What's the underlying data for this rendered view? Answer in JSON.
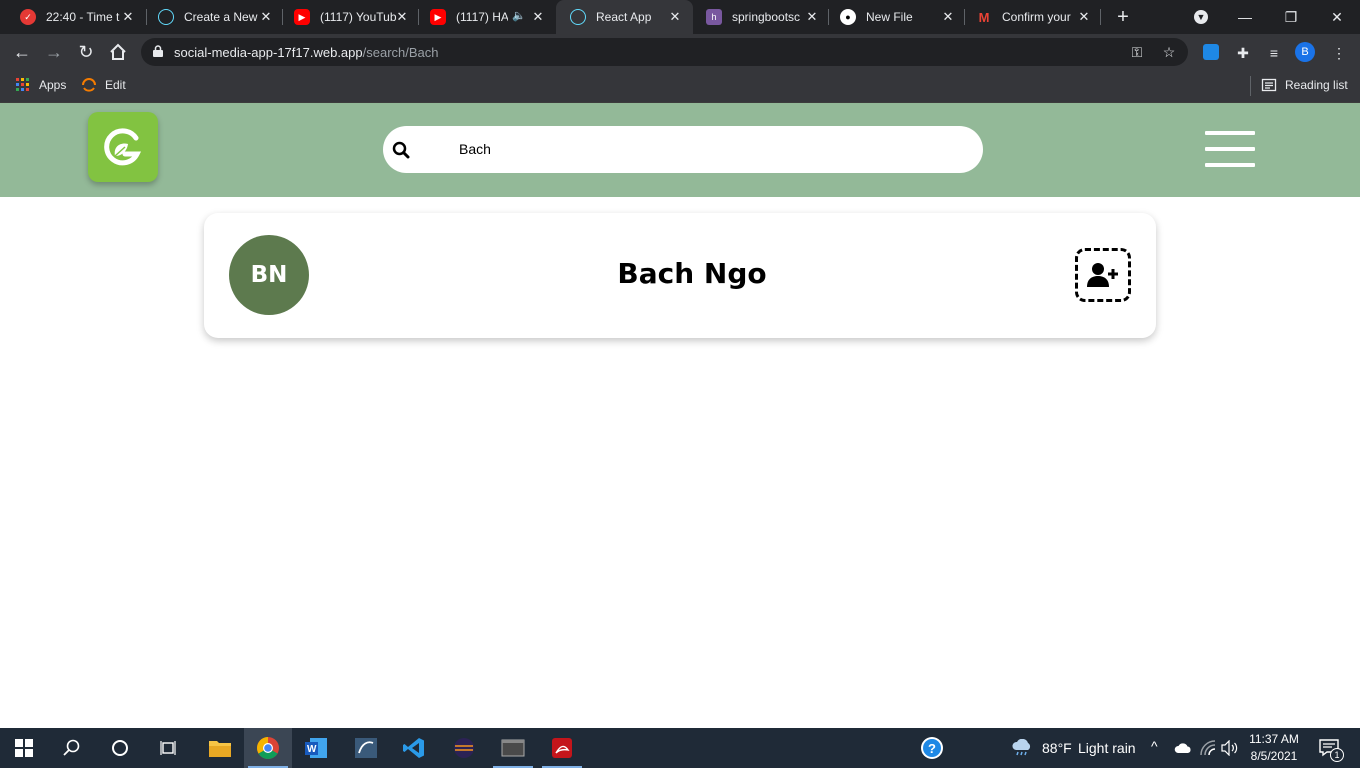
{
  "browser": {
    "tabs": [
      {
        "title": "22:40 - Time t",
        "icon": "check-circle-icon",
        "color": "#e53935"
      },
      {
        "title": "Create a New",
        "icon": "react-icon",
        "color": "#61dafb"
      },
      {
        "title": "(1117) YouTub",
        "icon": "youtube-icon",
        "color": "#ff0000"
      },
      {
        "title": "(1117) HA",
        "icon": "youtube-icon",
        "color": "#ff0000"
      },
      {
        "title": "React App",
        "icon": "react-icon",
        "color": "#61dafb"
      },
      {
        "title": "springbootsc",
        "icon": "heroku-icon",
        "color": "#79589f"
      },
      {
        "title": "New File",
        "icon": "github-icon",
        "color": "#ffffff"
      },
      {
        "title": "Confirm your",
        "icon": "gmail-icon",
        "color": "#ea4335"
      }
    ],
    "active_tab": 4,
    "url_host": "social-media-app-17f17.web.app",
    "url_path": "/search/Bach",
    "profile_initial": "B",
    "bookmarks": {
      "apps_label": "Apps",
      "edit_label": "Edit",
      "reading_list_label": "Reading list"
    }
  },
  "app": {
    "brand_color": "#93b998",
    "logo_color": "#82c341",
    "search": {
      "value": "Bach",
      "placeholder": ""
    },
    "results": [
      {
        "initials": "BN",
        "name": "Bach Ngo",
        "avatar_color": "#5d7a4e"
      }
    ]
  },
  "taskbar": {
    "weather_temp": "88°F",
    "weather_text": "Light rain",
    "time": "11:37 AM",
    "date": "8/5/2021",
    "notification_count": "1"
  }
}
